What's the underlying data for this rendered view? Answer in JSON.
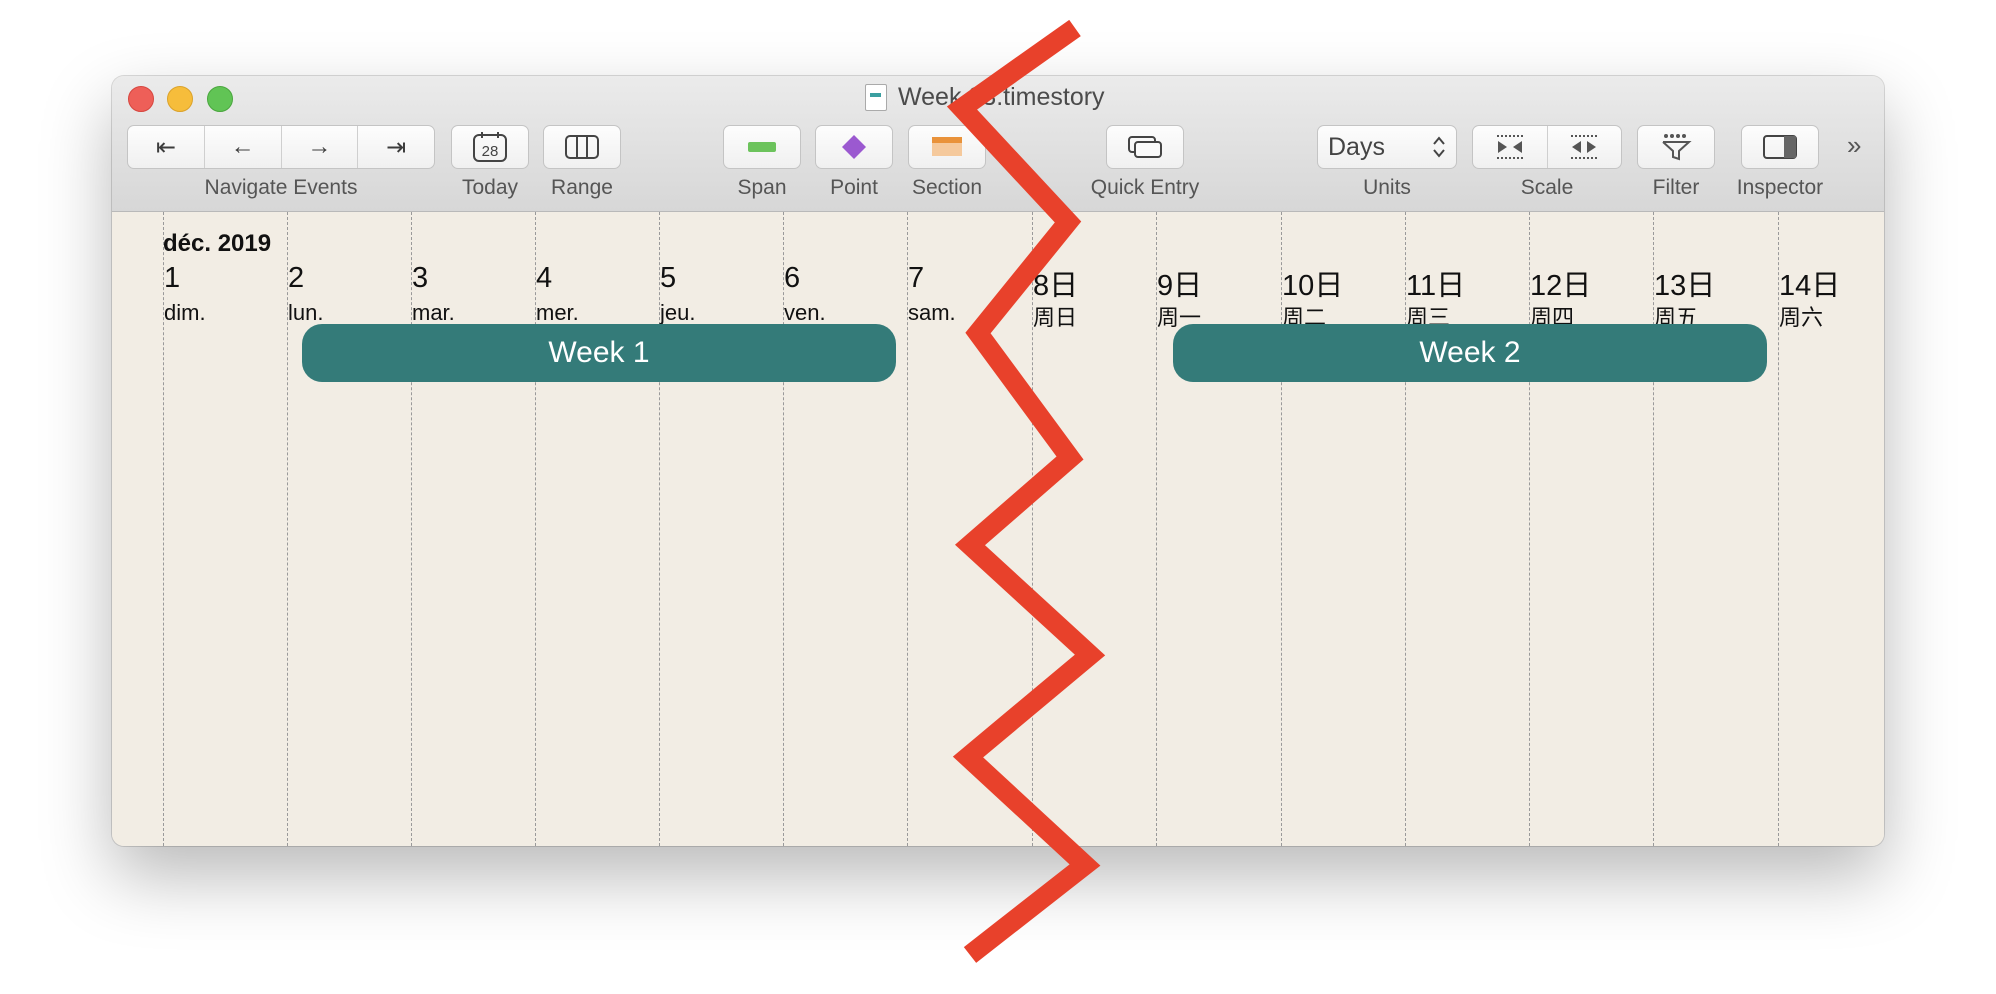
{
  "window": {
    "title": "Week 23.timestory"
  },
  "toolbar": {
    "navigate_label": "Navigate Events",
    "nav_icons": [
      "first-event-icon",
      "previous-event-icon",
      "next-event-icon",
      "last-event-icon"
    ],
    "nav_glyphs": [
      "⇤",
      "←",
      "→",
      "⇥"
    ],
    "today_label": "Today",
    "today_icon_text": "28",
    "range_label": "Range",
    "span_label": "Span",
    "point_label": "Point",
    "section_label": "Section",
    "quick_entry_label": "Quick Entry",
    "units_value": "Days",
    "units_label": "Units",
    "scale_label": "Scale",
    "filter_label": "Filter",
    "inspector_label": "Inspector",
    "overflow_glyph": "»",
    "colors": {
      "span_icon": "#6cc35c",
      "point_icon": "#9b59d0",
      "section_icon": "#f0b26e"
    }
  },
  "timeline": {
    "month": "déc. 2019",
    "days": [
      {
        "num": "1",
        "name": "dim."
      },
      {
        "num": "2",
        "name": "lun."
      },
      {
        "num": "3",
        "name": "mar."
      },
      {
        "num": "4",
        "name": "mer."
      },
      {
        "num": "5",
        "name": "jeu."
      },
      {
        "num": "6",
        "name": "ven."
      },
      {
        "num": "7",
        "name": "sam."
      },
      {
        "num": "8日",
        "name": "周日"
      },
      {
        "num": "9日",
        "name": "周一"
      },
      {
        "num": "10日",
        "name": "周二"
      },
      {
        "num": "11日",
        "name": "周三"
      },
      {
        "num": "12日",
        "name": "周四"
      },
      {
        "num": "13日",
        "name": "周五"
      },
      {
        "num": "14日",
        "name": "周六"
      }
    ],
    "spans": [
      {
        "label": "Week 1"
      },
      {
        "label": "Week 2"
      }
    ],
    "colors": {
      "background": "#f2ede4",
      "span": "#347b79",
      "annotation": "#e8412b"
    }
  }
}
